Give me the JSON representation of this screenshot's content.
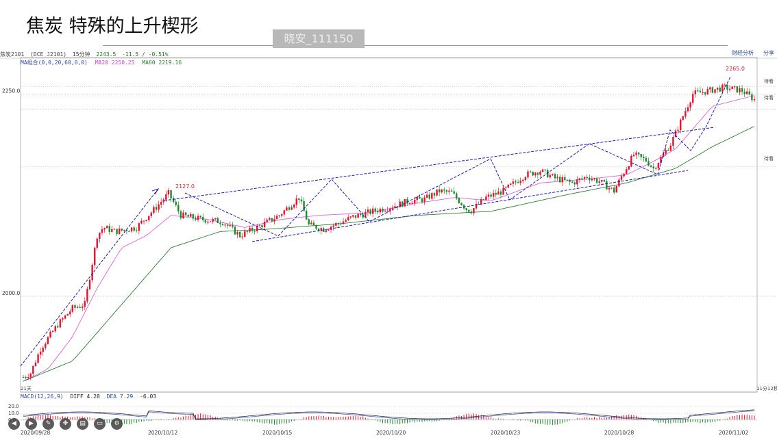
{
  "header": {
    "title": "焦炭 特殊的上升楔形",
    "watermark": "晓安_111150"
  },
  "top_right": {
    "label1": "财经分析",
    "label2": "分享"
  },
  "info_bar": {
    "symbol": "焦炭2101",
    "contract": "(DCE J2101)",
    "period": "15分钟",
    "last": "2243.5",
    "change": "-11.5 / -0.51%"
  },
  "ma_bar": {
    "label": "MA组合(0,0,20,60,0,0)",
    "ma20": "MA20 2250.25",
    "ma60": "MA60 2219.16"
  },
  "macd_bar": {
    "label": "MACD(12,26,9)",
    "diff": "DIFF 4.28",
    "dea": "DEA 7.29",
    "macd": "-6.03"
  },
  "right_labels": {
    "tag": "待看",
    "bottom": "11分12秒"
  },
  "bottom_left_label": "21天",
  "colors": {
    "up": "#e8102a",
    "down": "#1b8a2a",
    "ma20": "#e060e0",
    "ma60": "#2e7d32",
    "annotation": "#1a1ab8",
    "grid": "#b0b0b0"
  },
  "icons": [
    "play-back-icon",
    "play-icon",
    "pen-icon",
    "node-icon",
    "keyboard-icon",
    "screen-icon",
    "settings-icon"
  ],
  "chart_data": {
    "type": "candlestick",
    "title": "焦炭 特殊的上升楔形",
    "x_ticks": [
      "2020/09/28",
      "2020/10/12",
      "2020/10/15",
      "2020/10/20",
      "2020/10/23",
      "2020/10/28",
      "2020/11/02"
    ],
    "y_ticks": [
      2000.0,
      2250.0
    ],
    "ylim": [
      1890,
      2290
    ],
    "annotations": [
      {
        "label": "2127.0",
        "value": 2127.0
      },
      {
        "label": "2265.0",
        "value": 2265.0
      }
    ],
    "price_anchors": [
      [
        0,
        1900
      ],
      [
        6,
        1905
      ],
      [
        14,
        1935
      ],
      [
        28,
        1965
      ],
      [
        40,
        1985
      ],
      [
        50,
        1990
      ],
      [
        60,
        2075
      ],
      [
        65,
        2085
      ],
      [
        75,
        2080
      ],
      [
        92,
        2085
      ],
      [
        108,
        2110
      ],
      [
        118,
        2127
      ],
      [
        128,
        2100
      ],
      [
        145,
        2095
      ],
      [
        162,
        2092
      ],
      [
        176,
        2075
      ],
      [
        190,
        2085
      ],
      [
        208,
        2100
      ],
      [
        224,
        2122
      ],
      [
        232,
        2088
      ],
      [
        244,
        2083
      ],
      [
        256,
        2090
      ],
      [
        268,
        2098
      ],
      [
        284,
        2105
      ],
      [
        302,
        2112
      ],
      [
        314,
        2118
      ],
      [
        326,
        2120
      ],
      [
        338,
        2130
      ],
      [
        348,
        2128
      ],
      [
        360,
        2108
      ],
      [
        364,
        2106
      ],
      [
        376,
        2122
      ],
      [
        390,
        2130
      ],
      [
        408,
        2150
      ],
      [
        420,
        2155
      ],
      [
        432,
        2146
      ],
      [
        446,
        2140
      ],
      [
        458,
        2148
      ],
      [
        468,
        2142
      ],
      [
        480,
        2130
      ],
      [
        486,
        2148
      ],
      [
        496,
        2175
      ],
      [
        506,
        2168
      ],
      [
        512,
        2158
      ],
      [
        526,
        2188
      ],
      [
        544,
        2250
      ],
      [
        560,
        2255
      ],
      [
        570,
        2258
      ],
      [
        584,
        2254
      ],
      [
        594,
        2243
      ]
    ],
    "ma20_anchors": [
      [
        0,
        1895
      ],
      [
        20,
        1910
      ],
      [
        40,
        1950
      ],
      [
        60,
        2010
      ],
      [
        80,
        2060
      ],
      [
        100,
        2075
      ],
      [
        120,
        2100
      ],
      [
        150,
        2095
      ],
      [
        180,
        2085
      ],
      [
        210,
        2095
      ],
      [
        240,
        2100
      ],
      [
        280,
        2103
      ],
      [
        320,
        2115
      ],
      [
        350,
        2122
      ],
      [
        380,
        2118
      ],
      [
        420,
        2140
      ],
      [
        460,
        2145
      ],
      [
        490,
        2150
      ],
      [
        510,
        2165
      ],
      [
        530,
        2182
      ],
      [
        560,
        2235
      ],
      [
        594,
        2248
      ]
    ],
    "ma60_anchors": [
      [
        0,
        1895
      ],
      [
        40,
        1920
      ],
      [
        80,
        1990
      ],
      [
        120,
        2060
      ],
      [
        160,
        2080
      ],
      [
        200,
        2083
      ],
      [
        260,
        2090
      ],
      [
        320,
        2100
      ],
      [
        380,
        2105
      ],
      [
        440,
        2125
      ],
      [
        490,
        2140
      ],
      [
        530,
        2158
      ],
      [
        560,
        2185
      ],
      [
        594,
        2210
      ]
    ]
  }
}
